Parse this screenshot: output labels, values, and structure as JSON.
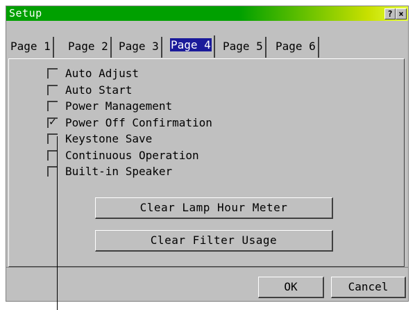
{
  "window": {
    "title": "Setup",
    "help_glyph": "?",
    "close_glyph": "×"
  },
  "tabs": [
    {
      "label": "Page 1",
      "active": false
    },
    {
      "label": "Page 2",
      "active": false
    },
    {
      "label": "Page 3",
      "active": false
    },
    {
      "label": "Page 4",
      "active": true
    },
    {
      "label": "Page 5",
      "active": false
    },
    {
      "label": "Page 6",
      "active": false
    }
  ],
  "options": [
    {
      "label": "Auto Adjust",
      "checked": false
    },
    {
      "label": "Auto Start",
      "checked": false
    },
    {
      "label": "Power Management",
      "checked": false
    },
    {
      "label": "Power Off Confirmation",
      "checked": true
    },
    {
      "label": "Keystone Save",
      "checked": false
    },
    {
      "label": "Continuous Operation",
      "checked": false
    },
    {
      "label": "Built-in Speaker",
      "checked": false
    }
  ],
  "check_glyph": "✓",
  "buttons": {
    "clear_lamp": "Clear Lamp Hour Meter",
    "clear_filter": "Clear Filter Usage",
    "ok": "OK",
    "cancel": "Cancel"
  },
  "colors": {
    "title_start": "#00a000",
    "title_end": "#e8ff40",
    "active_tab": "#1a1a9a",
    "face": "#c0c0c0"
  }
}
